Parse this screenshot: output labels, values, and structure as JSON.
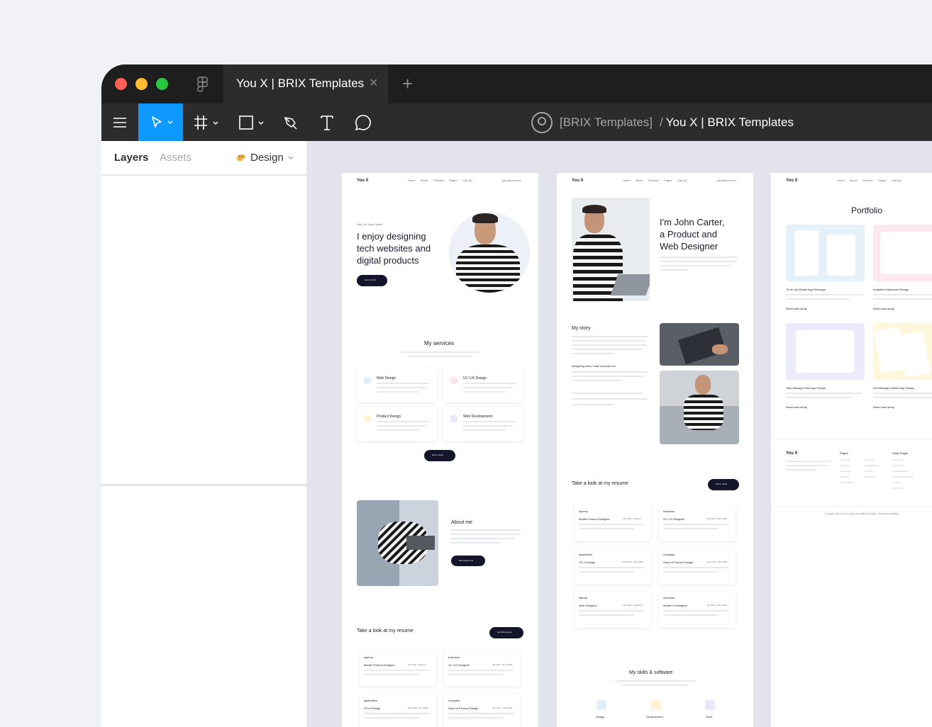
{
  "window": {
    "tab_title": "You X | BRIX Templates",
    "tab_close": "×",
    "tab_add": "+",
    "doc_team": "[BRIX Templates]",
    "doc_separator": "/",
    "doc_name": "You X | BRIX Templates"
  },
  "left_panel": {
    "layers": "Layers",
    "assets": "Assets",
    "design": "Design"
  },
  "frame1": {
    "logo": "You X",
    "nav": [
      "Home",
      "About",
      "Portfolio",
      "Pages",
      "Cart (0)"
    ],
    "email": "john@you.com",
    "hero_kicker": "Hey, I'm John Carter",
    "hero_title": [
      "I enjoy designing",
      "tech websites and",
      "digital products"
    ],
    "hero_btn": "Get in touch",
    "services_title": "My services",
    "services": [
      "Web Design",
      "UI / UX Design",
      "Product Design",
      "Web Development"
    ],
    "services_btn": "Get in touch",
    "about_title": "About me",
    "about_btn": "More about me",
    "resume_title": "Take a look at my resume",
    "resume_btn": "Get full resume",
    "resume_items": [
      {
        "company": "agency",
        "role": "Mobile Product Designer",
        "dates": "Jan 2020 - Present"
      },
      {
        "company": "business",
        "role": "UI / UX Designer",
        "dates": "Jan 2017 - Dec 2020"
      },
      {
        "company": "application",
        "role": "VP of Design",
        "dates": "Mar 2018 - Dec 2020"
      },
      {
        "company": "company",
        "role": "Head of Product Design",
        "dates": "Sep 2017 - Dec 2020"
      }
    ]
  },
  "frame2": {
    "logo": "You X",
    "nav": [
      "Home",
      "About",
      "Portfolio",
      "Pages",
      "Cart (0)"
    ],
    "email": "john@you.com",
    "hero_title": [
      "I'm John Carter,",
      "a Product and",
      "Web Designer"
    ],
    "story_title": "My story",
    "story_sub": "Designing since I was 16 years old",
    "resume_title": "Take a look at my resume",
    "resume_btn": "Get in touch",
    "resume_items": [
      {
        "company": "agency",
        "role": "Mobile Product Designer",
        "dates": "Jan 2020 - Present"
      },
      {
        "company": "business",
        "role": "UI / UX Designer",
        "dates": "Jan 2017 - Dec 2020"
      },
      {
        "company": "application",
        "role": "VP of Design",
        "dates": "Mar 2018 - Dec 2020"
      },
      {
        "company": "company",
        "role": "Head of Product Design",
        "dates": "Sep 2017 - Dec 2020"
      },
      {
        "company": "startup",
        "role": "Web Designer",
        "dates": "Jan 2015 - Aug 2017"
      },
      {
        "company": "incubator",
        "role": "Mobile UI Designer",
        "dates": "Jun 2016 - Dec 2019"
      }
    ],
    "skills_title": "My skills & software",
    "skills": [
      "Design",
      "Development",
      "Tools"
    ]
  },
  "frame3": {
    "logo": "You X",
    "nav": [
      "Home",
      "About",
      "Portfolio",
      "Pages",
      "Cart (0)"
    ],
    "portfolio_title": "Portfolio",
    "projects": [
      "To do List Mobile App Redesign",
      "Analytics Dashboard Design",
      "Task Manager Web App Design",
      "File Manager Mobile App Design"
    ],
    "read_more": "Read case study",
    "footer_logo": "You X",
    "footer_cols": [
      "Pages",
      "Utility Pages"
    ],
    "copyright": "Copyright © Moncose X | Designed by BRIX Templates - Powered by Webflow"
  },
  "colors": {
    "accent": "#0d99ff",
    "dark": "#14142b",
    "canvas": "#e3e3ee"
  }
}
